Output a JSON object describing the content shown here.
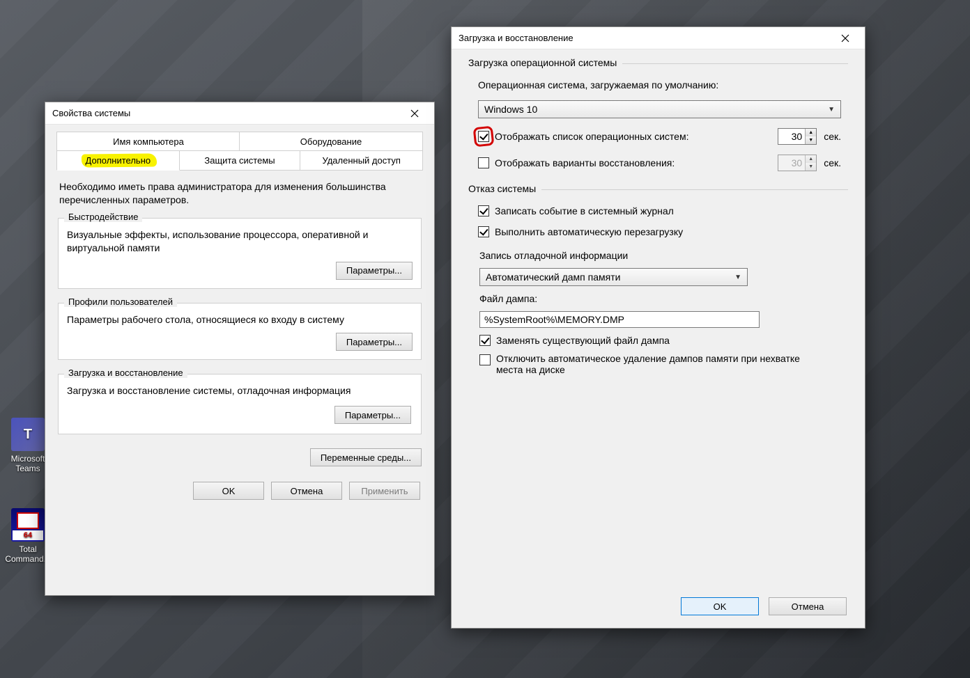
{
  "desktop": {
    "icons": {
      "teams": "Microsoft Teams",
      "tc": "Total Command..."
    }
  },
  "sysprops": {
    "title": "Свойства системы",
    "tabs": {
      "computer_name": "Имя компьютера",
      "hardware": "Оборудование",
      "advanced": "Дополнительно",
      "protection": "Защита системы",
      "remote": "Удаленный доступ"
    },
    "intro": "Необходимо иметь права администратора для изменения большинства перечисленных параметров.",
    "perf": {
      "legend": "Быстродействие",
      "desc": "Визуальные эффекты, использование процессора, оперативной и виртуальной памяти",
      "btn": "Параметры..."
    },
    "profiles": {
      "legend": "Профили пользователей",
      "desc": "Параметры рабочего стола, относящиеся ко входу в систему",
      "btn": "Параметры..."
    },
    "startup": {
      "legend": "Загрузка и восстановление",
      "desc": "Загрузка и восстановление системы, отладочная информация",
      "btn": "Параметры..."
    },
    "env_btn": "Переменные среды...",
    "ok": "OK",
    "cancel": "Отмена",
    "apply": "Применить"
  },
  "boot": {
    "title": "Загрузка и восстановление",
    "os_section": "Загрузка операционной системы",
    "default_label": "Операционная система, загружаемая по умолчанию:",
    "default_os": "Windows 10",
    "show_list": "Отображать список операционных систем:",
    "show_list_sec": "30",
    "sec_label": "сек.",
    "show_recovery": "Отображать варианты восстановления:",
    "show_recovery_sec": "30",
    "fail_section": "Отказ системы",
    "log_event": "Записать событие в системный журнал",
    "auto_restart": "Выполнить автоматическую перезагрузку",
    "dump_header": "Запись отладочной информации",
    "dump_type": "Автоматический дамп памяти",
    "dump_file_label": "Файл дампа:",
    "dump_file": "%SystemRoot%\\MEMORY.DMP",
    "overwrite": "Заменять существующий файл дампа",
    "no_autodelete": "Отключить автоматическое удаление дампов памяти при нехватке места на диске",
    "ok": "OK",
    "cancel": "Отмена"
  }
}
